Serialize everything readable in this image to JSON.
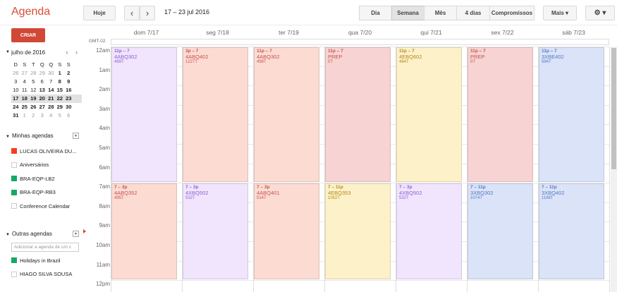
{
  "app_title": "Agenda",
  "toolbar": {
    "today_label": "Hoje",
    "prev_label": "‹",
    "next_label": "›",
    "date_range": "17 – 23 jul 2016",
    "views": [
      "Dia",
      "Semana",
      "Mês",
      "4 dias",
      "Compromissos"
    ],
    "selected_view": "Semana",
    "more_label": "Mais ▾",
    "settings_label": "⚙ ▾"
  },
  "sidebar": {
    "create_label": "CRIAR",
    "mini_calendar": {
      "month_label": "julho de 2016",
      "nav": "‹ ›",
      "weekdays": [
        "D",
        "S",
        "T",
        "Q",
        "Q",
        "S",
        "S"
      ],
      "weeks": [
        [
          "26",
          "27",
          "28",
          "29",
          "30",
          "1",
          "2"
        ],
        [
          "3",
          "4",
          "5",
          "6",
          "7",
          "8",
          "9"
        ],
        [
          "10",
          "11",
          "12",
          "13",
          "14",
          "15",
          "16"
        ],
        [
          "17",
          "18",
          "19",
          "20",
          "21",
          "22",
          "23"
        ],
        [
          "24",
          "25",
          "26",
          "27",
          "28",
          "29",
          "30"
        ],
        [
          "31",
          "1",
          "2",
          "3",
          "4",
          "5",
          "6"
        ]
      ],
      "highlighted_week": 3
    },
    "my_calendars_title": "Minhas agendas",
    "my_calendars": [
      {
        "name": "LUCAS OLIVEIRA DU...",
        "color": "#f83a22"
      },
      {
        "name": "Aniversários",
        "color": ""
      },
      {
        "name": "BRA-EQP-LB2",
        "color": "#16a765"
      },
      {
        "name": "BRA-EQP-RB3",
        "color": "#16a765"
      },
      {
        "name": "Conference Calendar",
        "color": ""
      }
    ],
    "other_calendars_title": "Outras agendas",
    "add_placeholder": "Adicionar a agenda de um c",
    "other_calendars": [
      {
        "name": "Holidays in Brazil",
        "color": "#16a765"
      },
      {
        "name": "HIAGO SILVA SOUSA",
        "color": ""
      }
    ]
  },
  "calendar": {
    "timezone": "GMT-02",
    "days": [
      "dom 7/17",
      "seg 7/18",
      "ter 7/19",
      "qua 7/20",
      "qui 7/21",
      "sex 7/22",
      "sáb 7/23"
    ],
    "hours": [
      "12am",
      "1am",
      "2am",
      "3am",
      "4am",
      "5am",
      "6am",
      "7am",
      "8am",
      "9am",
      "10am",
      "11am",
      "12pm"
    ],
    "events": [
      {
        "day": 0,
        "start": 0,
        "end": 7,
        "time": "11p – 7",
        "name": "4ABQ302",
        "code": "489T",
        "color": "#f1e4fd"
      },
      {
        "day": 1,
        "start": 0,
        "end": 7,
        "time": "3p – 7",
        "name": "4ABQ402",
        "code": "1227T",
        "color": "#fcdbd3"
      },
      {
        "day": 2,
        "start": 0,
        "end": 7,
        "time": "11p – 7",
        "name": "4ABQ302",
        "code": "498T",
        "color": "#fcdbd3"
      },
      {
        "day": 3,
        "start": 0,
        "end": 7,
        "time": "11p – 7",
        "name": "PREP",
        "code": "0T",
        "color": "#f7d3d3"
      },
      {
        "day": 4,
        "start": 0,
        "end": 7,
        "time": "11p – 7",
        "name": "4EBQ602",
        "code": "464T",
        "color": "#fdf1c9"
      },
      {
        "day": 5,
        "start": 0,
        "end": 7,
        "time": "11p – 7",
        "name": "PREP",
        "code": "0T",
        "color": "#f7d3d3"
      },
      {
        "day": 6,
        "start": 0,
        "end": 7,
        "time": "11p – 7",
        "name": "3XBE402",
        "code": "594T",
        "color": "#dae3f8"
      },
      {
        "day": 0,
        "start": 7,
        "end": 12,
        "time": "7 – 3p",
        "name": "4ABQ352",
        "code": "495T",
        "color": "#fcdbd3"
      },
      {
        "day": 1,
        "start": 7,
        "end": 12,
        "time": "7 – 3p",
        "name": "4XBQ502",
        "code": "532T",
        "color": "#f1e4fd"
      },
      {
        "day": 2,
        "start": 7,
        "end": 12,
        "time": "7 – 3p",
        "name": "4ABQ401",
        "code": "514T",
        "color": "#fcdbd3"
      },
      {
        "day": 3,
        "start": 7,
        "end": 12,
        "time": "7 – 11p",
        "name": "4EBQ353",
        "code": "1052T",
        "color": "#fdf1c9"
      },
      {
        "day": 4,
        "start": 7,
        "end": 12,
        "time": "7 – 3p",
        "name": "4XBQ502",
        "code": "532T",
        "color": "#f1e4fd"
      },
      {
        "day": 5,
        "start": 7,
        "end": 12,
        "time": "7 – 11p",
        "name": "3XBQ302",
        "code": "1074T",
        "color": "#dae3f8"
      },
      {
        "day": 6,
        "start": 7,
        "end": 12,
        "time": "7 – 11p",
        "name": "3XBQ402",
        "code": "1188T",
        "color": "#dae3f8"
      }
    ],
    "event_text_colors": {
      "#f1e4fd": "#8e63ce",
      "#fcdbd3": "#c5564a",
      "#f7d3d3": "#c5564a",
      "#fdf1c9": "#b08a18",
      "#dae3f8": "#5678c4"
    }
  }
}
